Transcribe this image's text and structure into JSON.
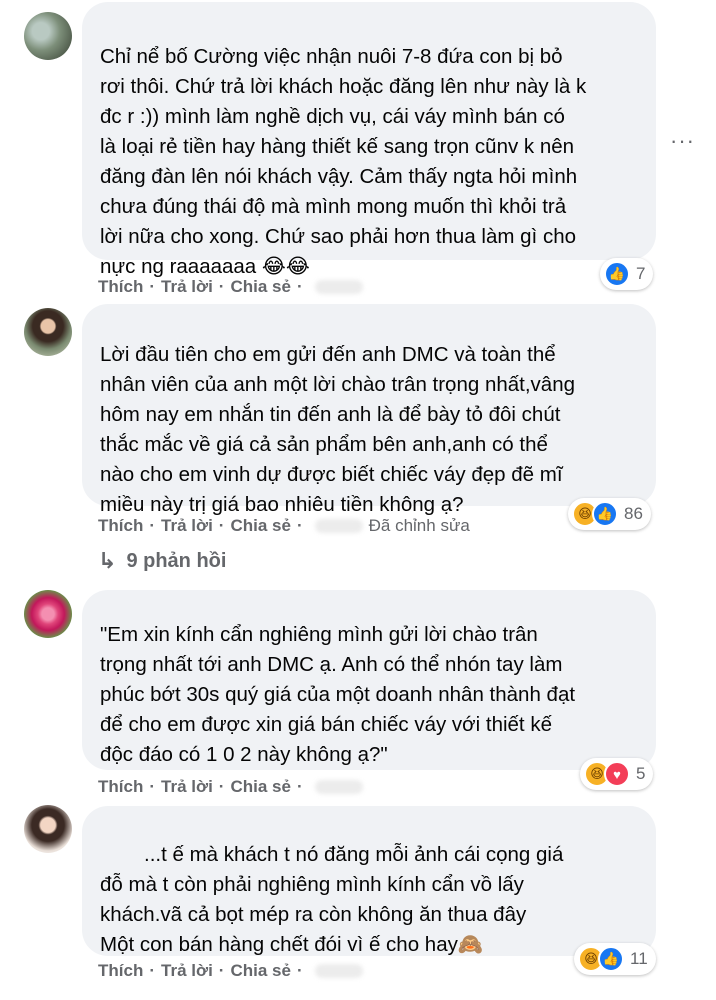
{
  "comments": [
    {
      "lines": [
        "Chỉ nể bố Cường việc nhận nuôi 7-8 đứa con bị bỏ",
        "rơi thôi. Chứ trả lời khách hoặc đăng lên như này là k",
        "đc r :)) mình làm nghề dịch vụ, cái váy mình bán có",
        "là loại rẻ tiền hay hàng thiết kế sang trọn cũnv k nên",
        "đăng đàn lên nói khách vậy. Cảm thấy ngta hỏi mình",
        "chưa đúng thái độ mà mình mong muốn thì khỏi trả",
        "lời nữa cho xong. Chứ sao phải hơn thua làm gì cho",
        "nực ng raaaaaaa 😂😂"
      ],
      "actions": {
        "like": "Thích",
        "reply": "Trả lời",
        "share": "Chia sẻ"
      },
      "reaction_count": "7"
    },
    {
      "lines": [
        "Lời đầu tiên cho em gửi đến anh DMC và toàn thể",
        "nhân viên của anh một lời chào trân trọng nhất,vâng",
        "hôm nay em nhắn tin đến anh là để bày tỏ đôi chút",
        "thắc mắc về giá cả sản phẩm bên anh,anh có thể",
        "nào cho em vinh dự được biết chiếc váy đẹp đẽ mĩ",
        "miều này trị giá bao nhiêu tiền không ạ?"
      ],
      "actions": {
        "like": "Thích",
        "reply": "Trả lời",
        "share": "Chia sẻ",
        "edited": "Đã chỉnh sửa"
      },
      "reaction_count": "86",
      "replies_label": "9 phản hồi"
    },
    {
      "lines": [
        "\"Em xin kính cẩn nghiêng mình gửi lời chào trân",
        "trọng nhất tới anh DMC ạ. Anh có thể nhón tay làm",
        "phúc bớt 30s quý giá của một doanh nhân thành đạt",
        "để cho em được xin giá bán chiếc váy với thiết kế",
        "độc đáo có 1 0 2 này không ạ?\""
      ],
      "actions": {
        "like": "Thích",
        "reply": "Trả lời",
        "share": "Chia sẻ"
      },
      "reaction_count": "5"
    },
    {
      "lines": [
        "...t ế mà khách t nó đăng mỗi ảnh cái cọng giá",
        "đỗ mà t còn phải nghiêng mình kính cẩn vồ lấy",
        "khách.vã cả bọt mép ra còn không ăn thua đây",
        "Một con bán hàng chết đói vì ế cho hay🙈"
      ],
      "actions": {
        "like": "Thích",
        "reply": "Trả lời",
        "share": "Chia sẻ"
      },
      "reaction_count": "11"
    }
  ],
  "colors": {
    "bubble": "#f0f2f5",
    "meta": "#65676b",
    "like": "#1877f2",
    "haha": "#f7b125",
    "love": "#f33e58"
  },
  "icons": {
    "reply_arrow": "↳",
    "more": "···",
    "wave": "👋"
  }
}
